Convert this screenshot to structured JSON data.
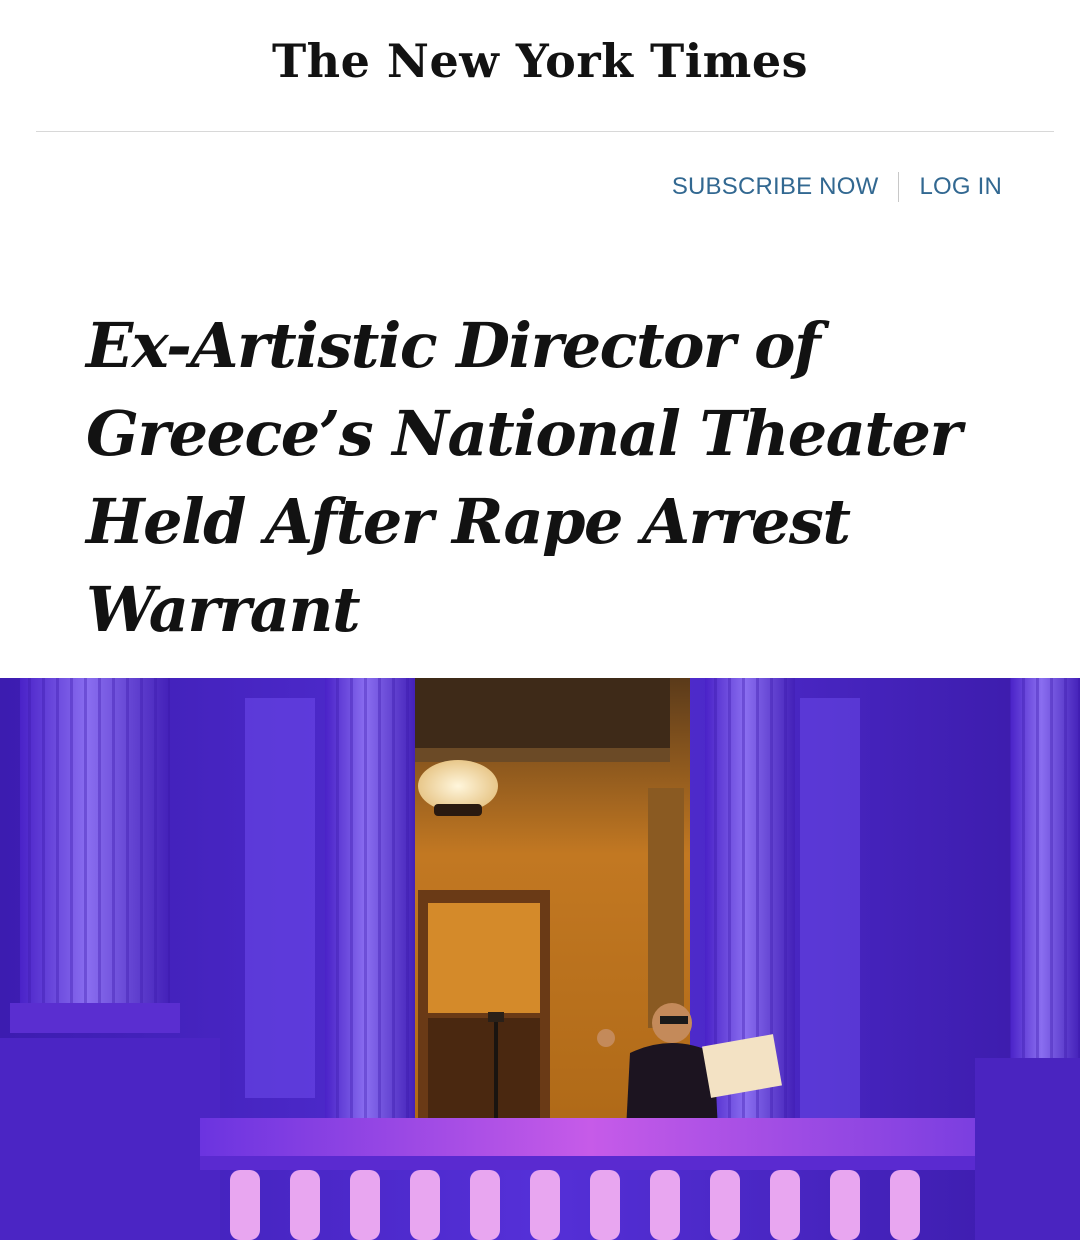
{
  "masthead": {
    "title": "The New York Times"
  },
  "account": {
    "subscribe_label": "SUBSCRIBE NOW",
    "login_label": "LOG IN"
  },
  "article": {
    "headline": "Ex-Artistic Director of Greece’s National Theater Held After Rape Arrest Warrant"
  },
  "colors": {
    "link": "#326891",
    "text": "#121212",
    "rule": "#d8d8d8",
    "photo_violet": "#5a2bd6",
    "photo_amber": "#c87a1e"
  }
}
